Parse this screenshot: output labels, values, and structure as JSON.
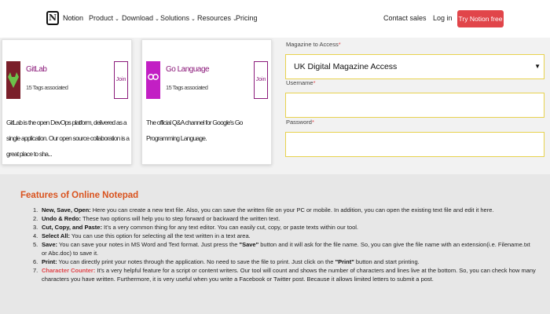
{
  "header": {
    "brand": "Notion",
    "logo_letter": "N",
    "nav": [
      {
        "label": "Product",
        "chevron": true
      },
      {
        "label": "Download",
        "chevron": true
      },
      {
        "label": "Solutions",
        "chevron": true
      },
      {
        "label": "Resources",
        "chevron": true
      },
      {
        "label": "Pricing",
        "chevron": false
      }
    ],
    "contact_sales": "Contact sales",
    "login": "Log in",
    "try_button": "Try Notion free"
  },
  "cards": [
    {
      "title": "GitLab",
      "subtitle": "15 Tags associated",
      "join": "Join",
      "description": "GitLab is the open DevOps platform, delivered as a single application. Our open source collaboration is a great place to sha..."
    },
    {
      "title": "Go Language",
      "subtitle": "15 Tags associated",
      "join": "Join",
      "description": "The official Q&A channel for Google's Go Programming Language."
    }
  ],
  "form": {
    "magazine_label": "Magazine to Access",
    "magazine_value": "UK Digital Magazine Access",
    "username_label": "Username",
    "password_label": "Password",
    "required_mark": "*"
  },
  "features": {
    "title": "Features of Online Notepad",
    "items": [
      {
        "num": "1.",
        "label": "New, Save, Open:",
        "text": " Here you can create a new text file. Also, you can save the written file on your PC or mobile. In addition, you can open the existing text file and edit it here."
      },
      {
        "num": "2.",
        "label": "Undo & Redo:",
        "text": " These two options will help you to step forward or backward the written text."
      },
      {
        "num": "3.",
        "label": "Cut, Copy, and Paste:",
        "text": " It's a very common thing for any text editor. You can easily cut, copy, or paste texts within our tool."
      },
      {
        "num": "4.",
        "label": "Select All:",
        "text": " You can use this option for selecting all the text written in a text area."
      },
      {
        "num": "5.",
        "label": "Save:",
        "text": " You can save your notes in MS Word and Text format. Just press the ",
        "quote": "\"Save\"",
        "text2": " button and it will ask for the file name. So, you can give the file name with an extension(i.e. Filename.txt or Abc.doc) to save it."
      },
      {
        "num": "6.",
        "label": "Print:",
        "text": " You can directly print your notes through the application. No need to save the file to print. Just click on the ",
        "quote": "\"Print\"",
        "text2": " button and start printing."
      },
      {
        "num": "7.",
        "label": "Character Counter:",
        "text": " It's a very helpful feature for a script or content writers. Our tool will count and shows the number of characters and lines live at the bottom. So, you can check how many characters you have written. Furthermore, it is very useful when you write a Facebook or Twitter post. Because it allows limited letters to submit a post."
      }
    ]
  },
  "colors": {
    "accent": "#e1454a",
    "feature_title": "#d9531e",
    "card_accent": "#8b1a7a",
    "field_border": "#e8d24e"
  }
}
